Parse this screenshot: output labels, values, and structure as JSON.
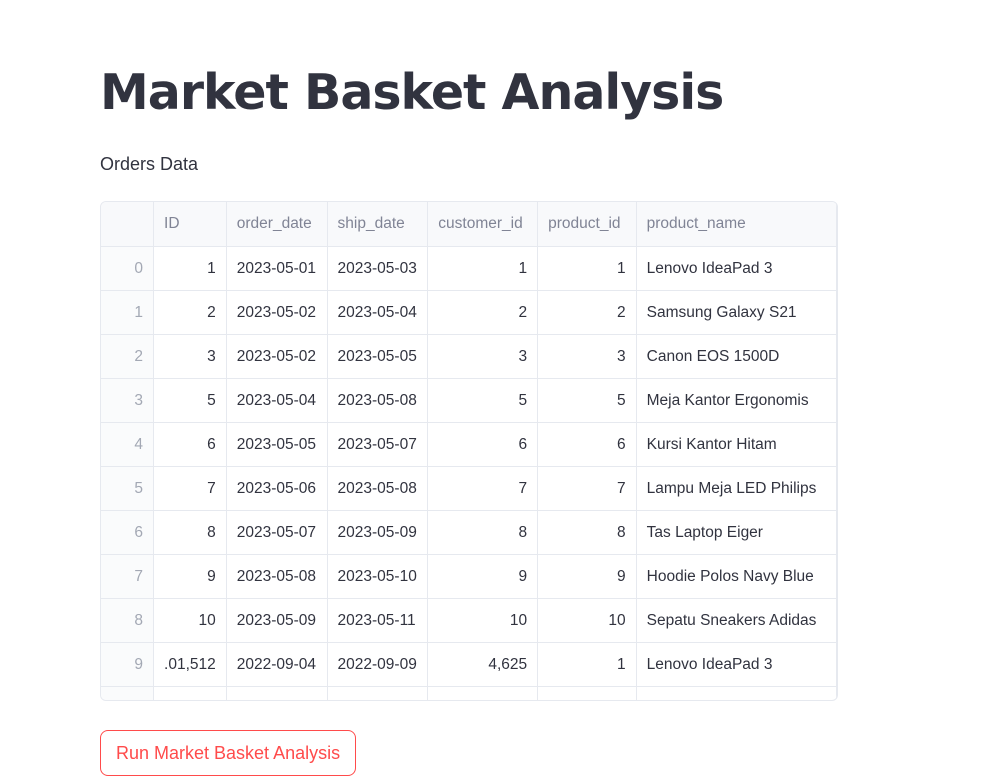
{
  "page": {
    "title": "Market Basket Analysis",
    "subtitle": "Orders Data"
  },
  "table": {
    "columns": [
      "",
      "ID",
      "order_date",
      "ship_date",
      "customer_id",
      "product_id",
      "product_name"
    ],
    "rows": [
      [
        "0",
        "1",
        "2023-05-01",
        "2023-05-03",
        "1",
        "1",
        "Lenovo IdeaPad 3"
      ],
      [
        "1",
        "2",
        "2023-05-02",
        "2023-05-04",
        "2",
        "2",
        "Samsung Galaxy S21"
      ],
      [
        "2",
        "3",
        "2023-05-02",
        "2023-05-05",
        "3",
        "3",
        "Canon EOS 1500D"
      ],
      [
        "3",
        "5",
        "2023-05-04",
        "2023-05-08",
        "5",
        "5",
        "Meja Kantor Ergonomis"
      ],
      [
        "4",
        "6",
        "2023-05-05",
        "2023-05-07",
        "6",
        "6",
        "Kursi Kantor Hitam"
      ],
      [
        "5",
        "7",
        "2023-05-06",
        "2023-05-08",
        "7",
        "7",
        "Lampu Meja LED Philips"
      ],
      [
        "6",
        "8",
        "2023-05-07",
        "2023-05-09",
        "8",
        "8",
        "Tas Laptop Eiger"
      ],
      [
        "7",
        "9",
        "2023-05-08",
        "2023-05-10",
        "9",
        "9",
        "Hoodie Polos Navy Blue"
      ],
      [
        "8",
        "10",
        "2023-05-09",
        "2023-05-11",
        "10",
        "10",
        "Sepatu Sneakers Adidas"
      ],
      [
        "9",
        ".01,512",
        "2022-09-04",
        "2022-09-09",
        "4,625",
        "1",
        "Lenovo IdeaPad 3"
      ]
    ]
  },
  "actions": {
    "run_label": "Run Market Basket Analysis"
  },
  "colors": {
    "text": "#31333f",
    "accent": "#ff4b4b",
    "header_text": "#808495",
    "border": "#e6e9ef"
  }
}
